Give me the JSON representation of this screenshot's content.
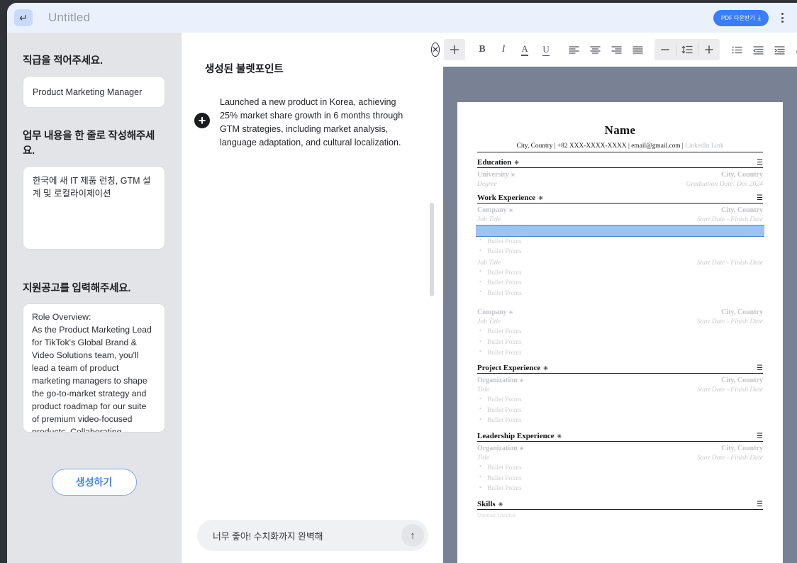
{
  "topbar": {
    "enter_icon": "enter-key-icon",
    "title": "Untitled",
    "pdf_button_label": "PDF 다운받기",
    "download_icon": "download-icon",
    "menu_icon": "kebab-menu-icon"
  },
  "sidebar": {
    "job_level": {
      "label": "직급을 적어주세요.",
      "value": "Product Marketing Manager",
      "placeholder": "Product Marketing Manager"
    },
    "job_summary": {
      "label": "업무 내용을 한 줄로 작성해주세요.",
      "value": "한국에 새 IT 제품 런칭, GTM 설계 및 로컬라이제이션"
    },
    "job_posting": {
      "label": "지원공고를 입력해주세요.",
      "value": "Role Overview:\nAs the Product Marketing Lead for TikTok's Global Brand & Video Solutions team, you'll lead a team of product marketing managers to shape the go-to-market strategy and product roadmap for our suite of premium video-focused products. Collaborating cross-..."
    },
    "generate_button": "생성하기"
  },
  "middle": {
    "heading": "생성된 불렛포인트",
    "add_icon": "plus-circle-icon",
    "bullet": "Launched a new product in Korea, achieving 25% market share growth in 6 months through GTM strategies, including market analysis, language adaptation, and cultural localization.",
    "chat_value": "너무 좋아! 수치화까지 완벽해",
    "chat_placeholder": "너무 좋아! 수치화까지 완벽해",
    "send_icon": "arrow-up-icon"
  },
  "toolbar": {
    "close_icon": "close-circle-icon",
    "add_icon": "plus-icon",
    "bold": "B",
    "italic": "I",
    "font_color": "A",
    "underline": "U",
    "align_left_icon": "align-left-icon",
    "align_center_icon": "align-center-icon",
    "align_right_icon": "align-right-icon",
    "align_justify_icon": "align-justify-icon",
    "decrease_icon": "minus-icon",
    "line_height_icon": "line-height-icon",
    "increase_icon": "plus-icon",
    "bullet_list_icon": "bullet-list-icon",
    "outdent_icon": "outdent-icon",
    "indent_icon": "indent-icon",
    "link_icon": "link-icon"
  },
  "resume": {
    "name": "Name",
    "contact": "City, Country | +82 XXX-XXXX-XXXX | email@gmail.com | ",
    "contact_muted": "LinkedIn Link",
    "section_dot": "✳",
    "menu_icon": "section-menu-icon",
    "bullet_label": "Bullet Points",
    "sections": [
      {
        "title": "Education",
        "entries": [
          {
            "org": "University",
            "location": "City, Country",
            "title": "Degree",
            "dates": "Graduation Date: Dec 2024",
            "bullets": []
          }
        ]
      },
      {
        "title": "Work Experience",
        "entries": [
          {
            "org": "Company",
            "location": "City, Country",
            "title": "Job Title",
            "dates": "Start Date - Finish Date",
            "bullets": [
              "Bullet Points",
              "Bullet Points",
              "Bullet Points"
            ],
            "selected_index": 0
          },
          {
            "org": "",
            "location": "",
            "title": "Job Title",
            "dates": "Start Date - Finish Date",
            "bullets": [
              "Bullet Points",
              "Bullet Points",
              "Bullet Points"
            ]
          },
          {
            "org": "Company",
            "location": "City, Country",
            "title": "Job Title",
            "dates": "Start Date - Finish Date",
            "bullets": [
              "Bullet Points",
              "Bullet Points",
              "Bullet Points"
            ]
          }
        ]
      },
      {
        "title": "Project Experience",
        "entries": [
          {
            "org": "Organization",
            "location": "City, Country",
            "title": "Title",
            "dates": "Start Date - Finish Date",
            "bullets": [
              "Bullet Points",
              "Bullet Points",
              "Bullet Points"
            ]
          }
        ]
      },
      {
        "title": "Leadership Experience",
        "entries": [
          {
            "org": "Organization",
            "location": "City, Country",
            "title": "Title",
            "dates": "Start Date - Finish Date",
            "bullets": [
              "Bullet Points",
              "Bullet Points",
              "Bullet Points"
            ]
          }
        ]
      },
      {
        "title": "Skills",
        "skills_line": "Untitled: Untitled",
        "entries": []
      }
    ]
  },
  "colors": {
    "accent_blue": "#3b7df4",
    "topbar_bg": "#eaf1fd",
    "sidebar_bg": "#e2e4e7",
    "canvas_bg": "#798294",
    "selection_blue": "#9dc2f3"
  }
}
